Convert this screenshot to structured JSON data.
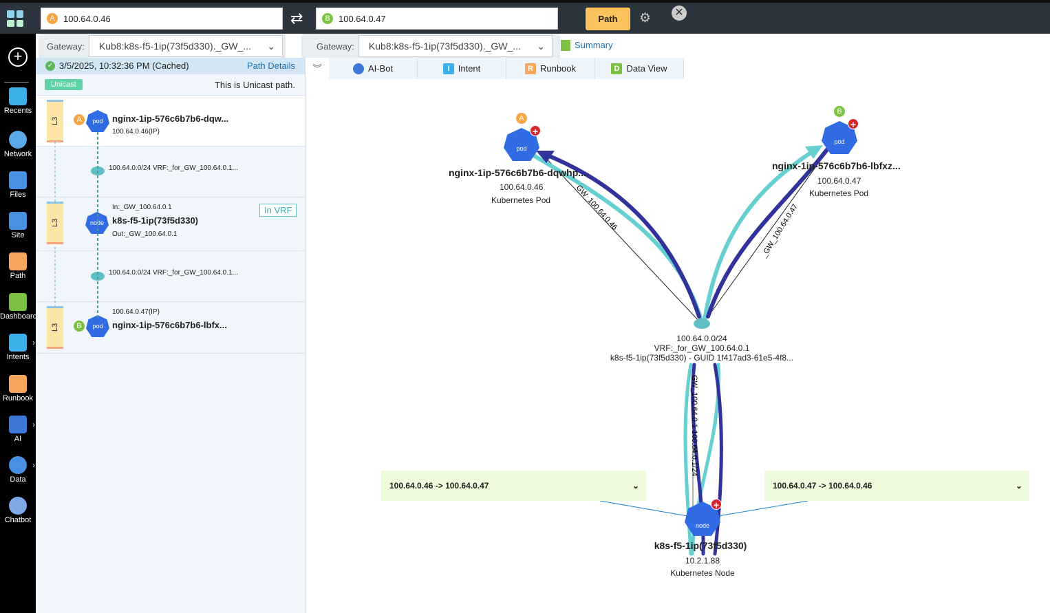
{
  "topbar": {
    "source": {
      "badge": "A",
      "value": "100.64.0.46"
    },
    "dest": {
      "badge": "B",
      "value": "100.64.0.47"
    },
    "path_button": "Path",
    "gateway_label": "Gateway:",
    "gateway_a": "Kub8:k8s-f5-1ip(73f5d330)._GW_...",
    "gateway_b": "Kub8:k8s-f5-1ip(73f5d330)._GW_...",
    "summary": "Summary"
  },
  "sidebar": {
    "items": [
      {
        "label": "Recents"
      },
      {
        "label": "Network"
      },
      {
        "label": "Files"
      },
      {
        "label": "Site"
      },
      {
        "label": "Path"
      },
      {
        "label": "Dashboard"
      },
      {
        "label": "Intents"
      },
      {
        "label": "Runbook"
      },
      {
        "label": "AI"
      },
      {
        "label": "Data"
      },
      {
        "label": "Chatbot"
      }
    ]
  },
  "tabs": [
    {
      "label": "AI-Bot"
    },
    {
      "label": "Intent",
      "icon": "I"
    },
    {
      "label": "Runbook",
      "icon": "R"
    },
    {
      "label": "Data View",
      "icon": "D"
    }
  ],
  "panel": {
    "timestamp": "3/5/2025, 10:32:36 PM (Cached)",
    "path_details": "Path Details",
    "unicast_tag": "Unicast",
    "unicast_text": "This is Unicast path.",
    "hops": [
      {
        "layer": "L3",
        "badge": "A",
        "name": "nginx-1ip-576c6b7b6-dqw...",
        "sub": "100.64.0.46(IP)",
        "icon": "pod"
      },
      {
        "subnet": "100.64.0.0/24 VRF:_for_GW_100.64.0.1..."
      },
      {
        "layer": "L3",
        "in": "In:_GW_100.64.0.1",
        "name": "k8s-f5-1ip(73f5d330)",
        "out": "Out:_GW_100.64.0.1",
        "tag": "In  VRF",
        "icon": "node"
      },
      {
        "subnet": "100.64.0.0/24 VRF:_for_GW_100.64.0.1..."
      },
      {
        "layer": "L3",
        "badge": "B",
        "name": "nginx-1ip-576c6b7b6-lbfx...",
        "sub": "100.64.0.47(IP)",
        "icon": "pod"
      }
    ]
  },
  "map": {
    "podA": {
      "badge": "A",
      "name": "nginx-1ip-576c6b7b6-dqwhp...",
      "ip": "100.64.0.46",
      "type": "Kubernetes Pod",
      "icon": "pod"
    },
    "podB": {
      "badge": "B",
      "name": "nginx-1ip-576c6b7b6-lbfxz...",
      "ip": "100.64.0.47",
      "type": "Kubernetes Pod",
      "icon": "pod"
    },
    "subnet": {
      "l1": "100.64.0.0/24",
      "l2": "VRF:_for_GW_100.64.0.1",
      "l3": "k8s-f5-1ip(73f5d330) - GUID 1f417ad3-61e5-4f8..."
    },
    "node": {
      "name": "k8s-f5-1ip(73f5d330)",
      "ip": "10.2.1.88",
      "type": "Kubernetes Node",
      "icon": "node"
    },
    "edge_a": "GW_100.64.0.46",
    "edge_b": "_GW_100.64.0.47",
    "edge_node": "GW_100.64.0.1 100.64.0.1/24",
    "flow1": "100.64.0.46 -> 100.64.0.47",
    "flow2": "100.64.0.47 -> 100.64.0.46"
  },
  "colors": {
    "accent_path": "#32339a",
    "path_return": "#66cfd0",
    "pod": "#326ce5",
    "path_button": "#fbc35c"
  }
}
